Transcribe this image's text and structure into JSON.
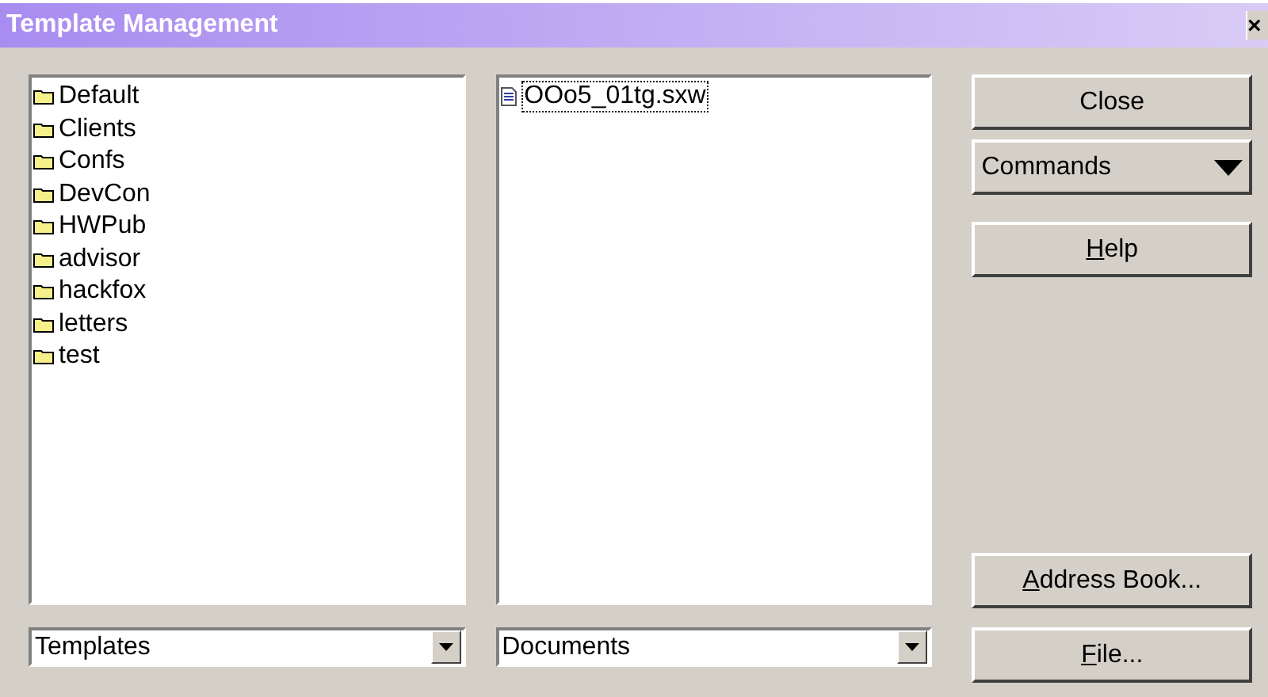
{
  "window": {
    "title": "Template Management",
    "close": "×"
  },
  "categories": [
    {
      "label": "Default",
      "selected": false
    },
    {
      "label": "Clients",
      "selected": false
    },
    {
      "label": "Confs",
      "selected": false
    },
    {
      "label": "DevCon",
      "selected": false
    },
    {
      "label": "HWPub",
      "selected": false
    },
    {
      "label": "advisor",
      "selected": false
    },
    {
      "label": "hackfox",
      "selected": false
    },
    {
      "label": "letters",
      "selected": false
    },
    {
      "label": "test",
      "selected": false
    }
  ],
  "documents": [
    {
      "label": "OOo5_01tg.sxw",
      "selected": true
    }
  ],
  "left_dropdown": {
    "value": "Templates"
  },
  "right_dropdown": {
    "value": "Documents"
  },
  "buttons_top": [
    {
      "kind": "button",
      "rest": "Close"
    },
    {
      "kind": "menu",
      "rest": "Commands"
    },
    {
      "kind": "button",
      "key": "H",
      "rest": "elp"
    }
  ],
  "buttons_bottom": [
    {
      "kind": "button",
      "key": "A",
      "rest": "ddress Book..."
    },
    {
      "kind": "button",
      "key": "F",
      "rest": "ile..."
    }
  ]
}
